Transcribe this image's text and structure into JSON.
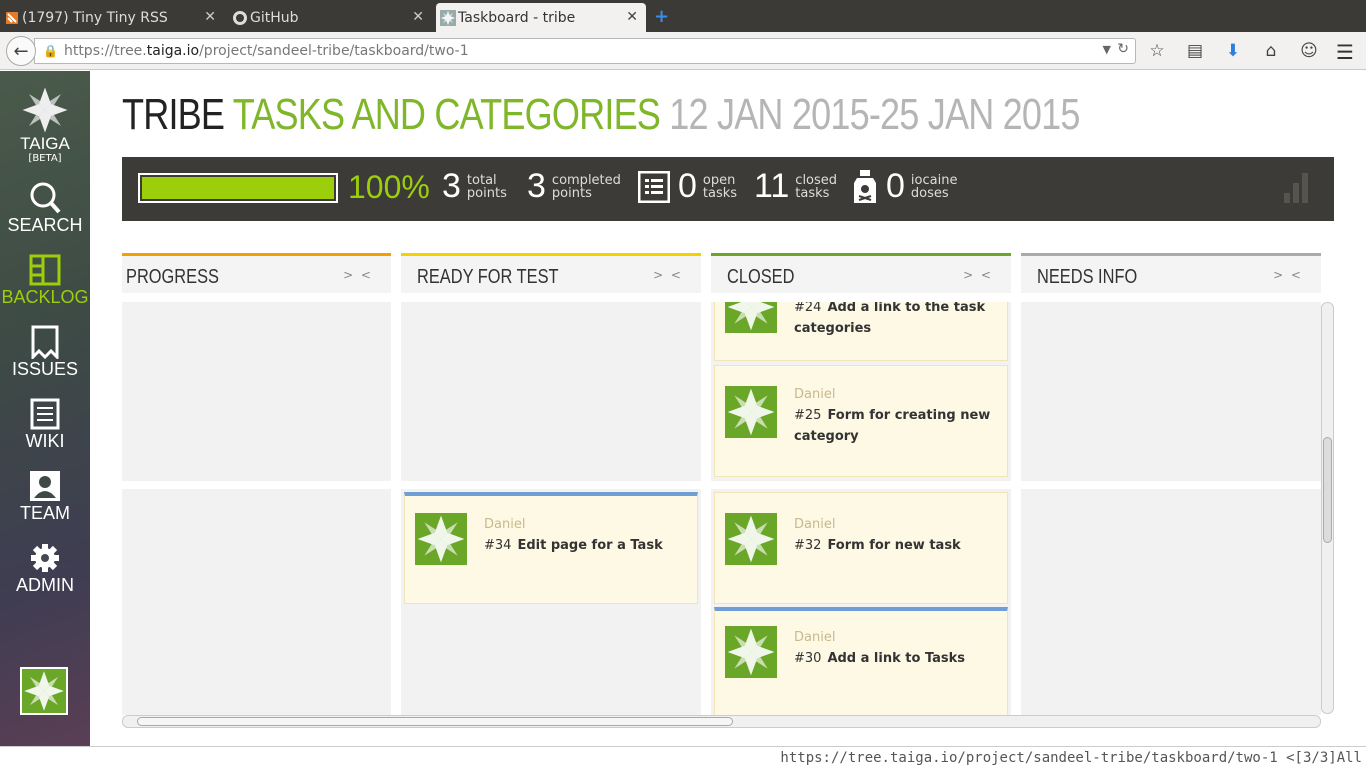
{
  "browser": {
    "tabs": [
      {
        "label": "(1797) Tiny Tiny RSS"
      },
      {
        "label": "GitHub"
      },
      {
        "label": "Taskboard - tribe"
      }
    ],
    "url": {
      "prefix": "https://tree.",
      "domain": "taiga.io",
      "path": "/project/sandeel-tribe/taskboard/two-1"
    },
    "status_text": "https://tree.taiga.io/project/sandeel-tribe/taskboard/two-1 <[3/3]All"
  },
  "sidebar": {
    "logo_text": "TAIGA",
    "logo_beta": "[BETA]",
    "items": [
      {
        "label": "SEARCH"
      },
      {
        "label": "BACKLOG"
      },
      {
        "label": "ISSUES"
      },
      {
        "label": "WIKI"
      },
      {
        "label": "TEAM"
      },
      {
        "label": "ADMIN"
      }
    ]
  },
  "header": {
    "project": "TRIBE",
    "sprint": "TASKS AND CATEGORIES",
    "dates": "12 JAN 2015-25 JAN 2015"
  },
  "summary": {
    "progress_fraction": 1.0,
    "percent": "100%",
    "total_points": "3",
    "total_points_label1": "total",
    "total_points_label2": "points",
    "completed_points": "3",
    "completed_points_label1": "completed",
    "completed_points_label2": "points",
    "open_tasks": "0",
    "open_tasks_label1": "open",
    "open_tasks_label2": "tasks",
    "closed_tasks": "11",
    "closed_tasks_label1": "closed",
    "closed_tasks_label2": "tasks",
    "iocaine": "0",
    "iocaine_label1": "iocaine",
    "iocaine_label2": "doses"
  },
  "columns": [
    {
      "label": "PROGRESS",
      "color": "#f2a000"
    },
    {
      "label": "READY FOR TEST",
      "color": "#f2d300"
    },
    {
      "label": "CLOSED",
      "color": "#6aa628"
    },
    {
      "label": "NEEDS INFO",
      "color": "#aaaaaa"
    }
  ],
  "fold_symbol": "> <",
  "cards": {
    "c24": {
      "ref": "#24",
      "title": "Add a link to the task categories"
    },
    "c25": {
      "owner": "Daniel",
      "ref": "#25",
      "title": "Form for creating new category"
    },
    "c34": {
      "owner": "Daniel",
      "ref": "#34",
      "title": "Edit page for a Task"
    },
    "c32": {
      "owner": "Daniel",
      "ref": "#32",
      "title": "Form for new task"
    },
    "c30": {
      "owner": "Daniel",
      "ref": "#30",
      "title": "Add a link to Tasks"
    }
  }
}
